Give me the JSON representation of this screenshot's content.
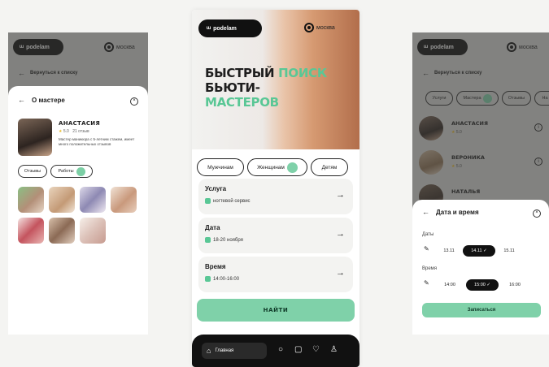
{
  "brand": {
    "logo": "podelam",
    "city": "москва"
  },
  "left": {
    "back_label": "Вернуться к списку",
    "sheet_title": "О мастере",
    "master_name": "АНАСТАСИЯ",
    "rating": "5.0",
    "reviews": "21 отзыв",
    "description": "Мастер маникюра с 5-летним стажем, имеет много положительных отзывов",
    "tabs": [
      "Отзывы",
      "Работы"
    ]
  },
  "center": {
    "hero_line1_dark": "БЫСТРЫЙ",
    "hero_line1_green": "ПОИСК",
    "hero_line2": "БЬЮТИ-",
    "hero_line3": "МАСТЕРОВ",
    "categories": [
      "Мужчинам",
      "Женщинам",
      "Детям"
    ],
    "fields": [
      {
        "label": "Услуга",
        "value": "ногтевой сервис"
      },
      {
        "label": "Дата",
        "value": "18-20 ноября"
      },
      {
        "label": "Время",
        "value": "14:00-16:00"
      }
    ],
    "find_button": "НАЙТИ",
    "tabbar": {
      "home": "Главная"
    }
  },
  "right": {
    "back_label": "Вернуться к списку",
    "filters": [
      "Услуги",
      "Мастера",
      "Отзывы",
      "На"
    ],
    "masters": [
      {
        "name": "АНАСТАСИЯ",
        "rating": "5.0"
      },
      {
        "name": "ВЕРОНИКА",
        "rating": "5.0"
      },
      {
        "name": "НАТАЛЬЯ",
        "rating": ""
      }
    ],
    "sheet_title": "Дата и время",
    "dates_label": "Даты",
    "dates": [
      "13.11",
      "14.11 ✓",
      "15.11"
    ],
    "time_label": "Время",
    "times": [
      "14:00",
      "15:00 ✓",
      "16:00"
    ],
    "apply_button": "Записаться"
  },
  "colors": {
    "accent": "#7fd1a9",
    "accent_text": "#59c795",
    "dark": "#111111"
  }
}
